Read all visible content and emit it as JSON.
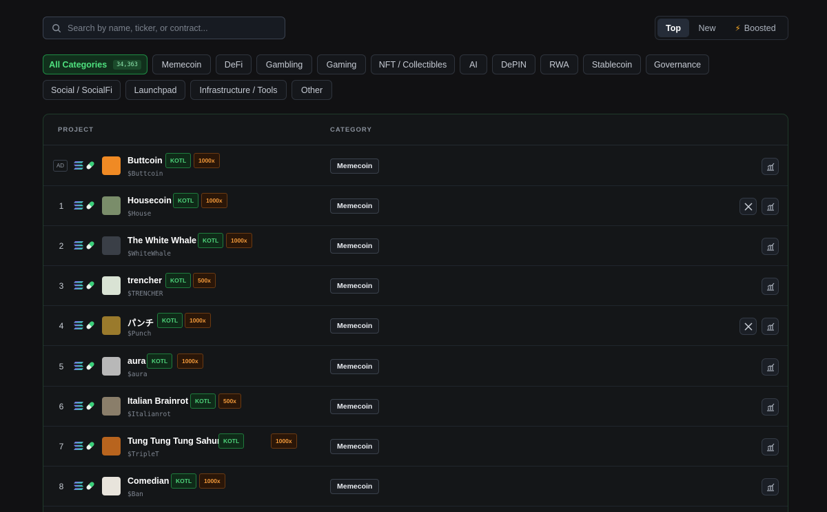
{
  "search": {
    "placeholder": "Search by name, ticker, or contract..."
  },
  "sort": {
    "top": "Top",
    "new": "New",
    "boosted": "Boosted",
    "active": "Top"
  },
  "categories": [
    {
      "label": "All Categories",
      "count": "34,363",
      "active": true
    },
    {
      "label": "Memecoin"
    },
    {
      "label": "DeFi"
    },
    {
      "label": "Gambling"
    },
    {
      "label": "Gaming"
    },
    {
      "label": "NFT / Collectibles"
    },
    {
      "label": "AI"
    },
    {
      "label": "DePIN"
    },
    {
      "label": "RWA"
    },
    {
      "label": "Stablecoin"
    },
    {
      "label": "Governance"
    },
    {
      "label": "Social / SocialFi"
    },
    {
      "label": "Launchpad"
    },
    {
      "label": "Infrastructure / Tools"
    },
    {
      "label": "Other"
    }
  ],
  "table": {
    "headers": {
      "project": "PROJECT",
      "category": "CATEGORY"
    },
    "rows": [
      {
        "rank": "AD",
        "name": "Buttcoin",
        "ticker": "$Buttcoin",
        "kotl": "KOTL",
        "mult": "1000x",
        "category": "Memecoin",
        "has_x": false,
        "logo_color": "#f08a24"
      },
      {
        "rank": "1",
        "name": "Housecoin",
        "ticker": "$House",
        "kotl": "KOTL",
        "mult": "1000x",
        "category": "Memecoin",
        "has_x": true,
        "logo_color": "#7a8d6a"
      },
      {
        "rank": "2",
        "name": "The White Whale",
        "ticker": "$WhiteWhale",
        "kotl": "KOTL",
        "mult": "1000x",
        "category": "Memecoin",
        "has_x": false,
        "logo_color": "#3a3f47"
      },
      {
        "rank": "3",
        "name": "trencher",
        "ticker": "$TRENCHER",
        "kotl": "KOTL",
        "mult": "500x",
        "category": "Memecoin",
        "has_x": false,
        "logo_color": "#d9e3d4"
      },
      {
        "rank": "4",
        "name": "パンチ",
        "ticker": "$Punch",
        "kotl": "KOTL",
        "mult": "1000x",
        "category": "Memecoin",
        "has_x": true,
        "logo_color": "#9a7a2c"
      },
      {
        "rank": "5",
        "name": "aura",
        "ticker": "$aura",
        "kotl": "KOTL",
        "mult": "1000x",
        "category": "Memecoin",
        "has_x": false,
        "logo_color": "#b8b8b8"
      },
      {
        "rank": "6",
        "name": "Italian Brainrot",
        "ticker": "$Italianrot",
        "kotl": "KOTL",
        "mult": "500x",
        "category": "Memecoin",
        "has_x": false,
        "logo_color": "#8a7e6a"
      },
      {
        "rank": "7",
        "name": "Tung Tung Tung Sahur",
        "ticker": "$TripleT",
        "kotl": "KOTL",
        "mult": "1000x",
        "category": "Memecoin",
        "has_x": false,
        "logo_color": "#b8641e"
      },
      {
        "rank": "8",
        "name": "Comedian",
        "ticker": "$Ban",
        "kotl": "KOTL",
        "mult": "1000x",
        "category": "Memecoin",
        "has_x": false,
        "logo_color": "#e8e4dc"
      }
    ]
  }
}
